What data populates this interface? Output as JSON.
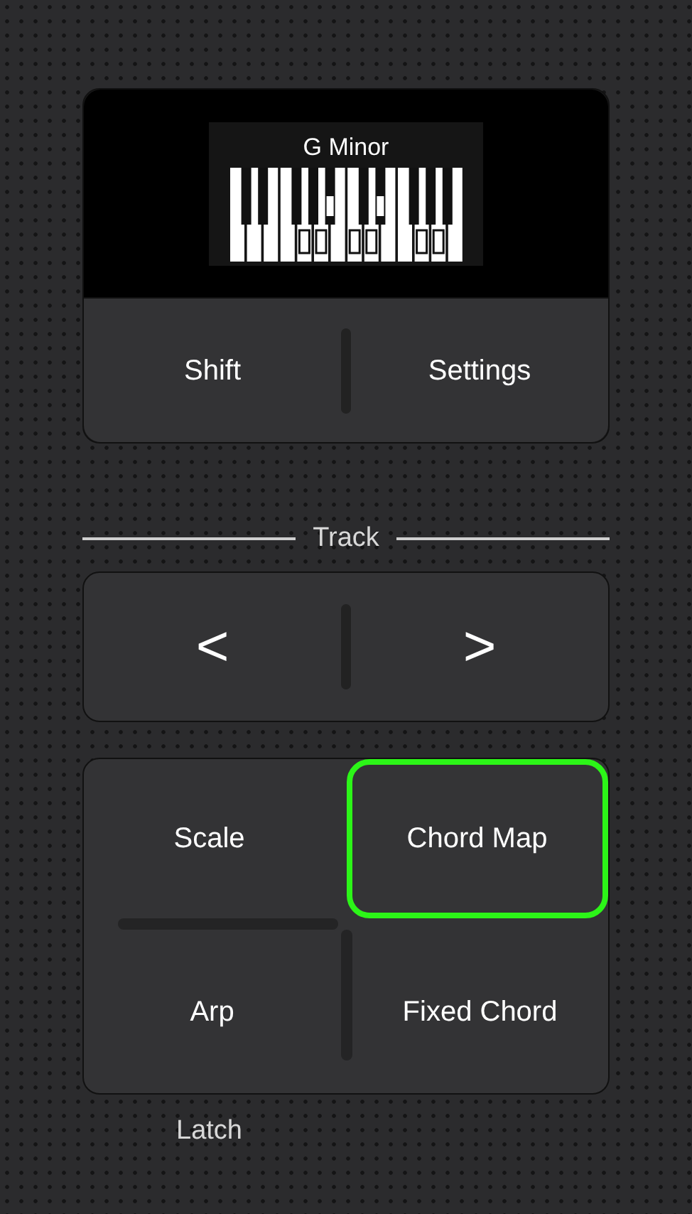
{
  "display": {
    "title": "G Minor"
  },
  "top_buttons": [
    {
      "label": "Shift"
    },
    {
      "label": "Settings"
    }
  ],
  "track": {
    "label": "Track",
    "prev": "<",
    "next": ">"
  },
  "modes": [
    {
      "label": "Scale",
      "selected": false
    },
    {
      "label": "Chord Map",
      "selected": true
    },
    {
      "label": "Arp",
      "selected": false
    },
    {
      "label": "Fixed Chord",
      "selected": false
    }
  ],
  "latch": {
    "label": "Latch"
  }
}
